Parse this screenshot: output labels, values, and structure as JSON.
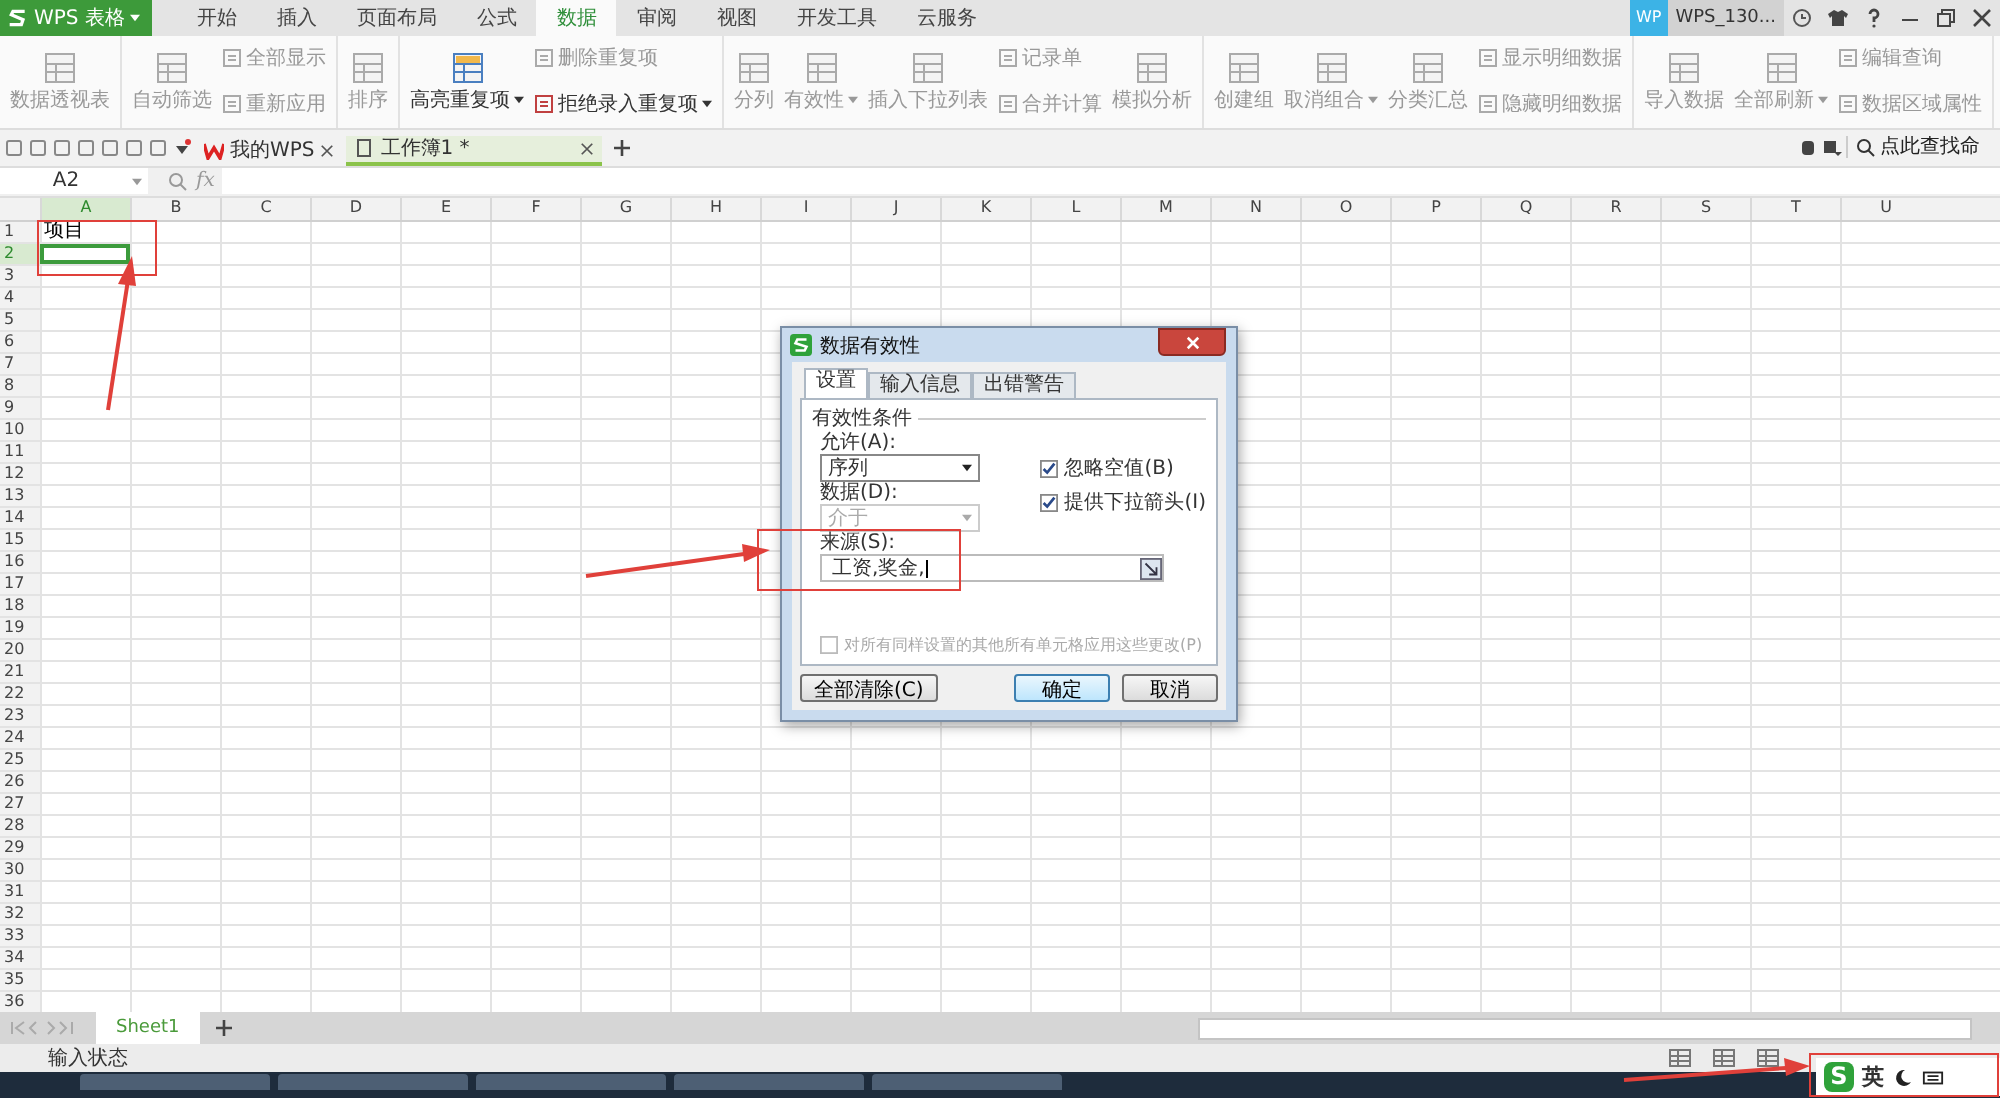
{
  "app_button": {
    "label": "WPS 表格"
  },
  "ribbon_tabs": [
    {
      "label": "开始",
      "selected": false
    },
    {
      "label": "插入",
      "selected": false
    },
    {
      "label": "页面布局",
      "selected": false
    },
    {
      "label": "公式",
      "selected": false
    },
    {
      "label": "数据",
      "selected": true
    },
    {
      "label": "审阅",
      "selected": false
    },
    {
      "label": "视图",
      "selected": false
    },
    {
      "label": "开发工具",
      "selected": false
    },
    {
      "label": "云服务",
      "selected": false
    }
  ],
  "account": {
    "badge": "WP",
    "name": "WPS_130..."
  },
  "ribbon_groups": [
    {
      "columns": [
        [
          {
            "label": "数据透视表",
            "kind": "large",
            "dropdown": false,
            "disabled": true
          }
        ]
      ]
    },
    {
      "columns": [
        [
          {
            "label": "自动筛选",
            "kind": "large",
            "dropdown": false,
            "disabled": true
          }
        ],
        [
          {
            "label": "全部显示",
            "kind": "small",
            "dropdown": false,
            "disabled": true
          },
          {
            "label": "重新应用",
            "kind": "small",
            "dropdown": false,
            "disabled": true
          }
        ]
      ]
    },
    {
      "columns": [
        [
          {
            "label": "排序",
            "kind": "large",
            "dropdown": false,
            "disabled": true
          }
        ]
      ]
    },
    {
      "columns": [
        [
          {
            "label": "高亮重复项",
            "kind": "large",
            "dropdown": true,
            "disabled": false
          }
        ],
        [
          {
            "label": "删除重复项",
            "kind": "small",
            "dropdown": false,
            "disabled": true
          },
          {
            "label": "拒绝录入重复项",
            "kind": "small",
            "dropdown": true,
            "disabled": false
          }
        ]
      ]
    },
    {
      "columns": [
        [
          {
            "label": "分列",
            "kind": "large",
            "dropdown": false,
            "disabled": true
          }
        ],
        [
          {
            "label": "有效性",
            "kind": "large",
            "dropdown": true,
            "disabled": true
          }
        ],
        [
          {
            "label": "插入下拉列表",
            "kind": "large",
            "dropdown": false,
            "disabled": true
          }
        ],
        [
          {
            "label": "记录单",
            "kind": "small",
            "dropdown": false,
            "disabled": true
          },
          {
            "label": "合并计算",
            "kind": "small",
            "dropdown": false,
            "disabled": true
          }
        ],
        [
          {
            "label": "模拟分析",
            "kind": "large",
            "dropdown": false,
            "disabled": true
          }
        ]
      ]
    },
    {
      "columns": [
        [
          {
            "label": "创建组",
            "kind": "large",
            "dropdown": false,
            "disabled": true
          }
        ],
        [
          {
            "label": "取消组合",
            "kind": "large",
            "dropdown": true,
            "disabled": true
          }
        ],
        [
          {
            "label": "分类汇总",
            "kind": "large",
            "dropdown": false,
            "disabled": true
          }
        ],
        [
          {
            "label": "显示明细数据",
            "kind": "small",
            "dropdown": false,
            "disabled": true
          },
          {
            "label": "隐藏明细数据",
            "kind": "small",
            "dropdown": false,
            "disabled": true
          }
        ]
      ]
    },
    {
      "columns": [
        [
          {
            "label": "导入数据",
            "kind": "large",
            "dropdown": false,
            "disabled": true
          }
        ],
        [
          {
            "label": "全部刷新",
            "kind": "large",
            "dropdown": true,
            "disabled": true
          }
        ],
        [
          {
            "label": "编辑查询",
            "kind": "small",
            "dropdown": false,
            "disabled": true
          },
          {
            "label": "数据区域属性",
            "kind": "small",
            "dropdown": false,
            "disabled": true
          }
        ]
      ]
    }
  ],
  "doc_tabs": [
    {
      "label": "我的WPS",
      "selected": false
    },
    {
      "label": "工作簿1 *",
      "selected": true
    }
  ],
  "command_search": {
    "placeholder": "点此查找命"
  },
  "formula_bar": {
    "cell_name": "A2",
    "fx_label": "fx"
  },
  "sheet": {
    "columns": [
      {
        "label": "A",
        "selected": true
      },
      {
        "label": "B",
        "selected": false
      },
      {
        "label": "C",
        "selected": false
      },
      {
        "label": "D",
        "selected": false
      },
      {
        "label": "E",
        "selected": false
      },
      {
        "label": "F",
        "selected": false
      },
      {
        "label": "G",
        "selected": false
      },
      {
        "label": "H",
        "selected": false
      },
      {
        "label": "I",
        "selected": false
      },
      {
        "label": "J",
        "selected": false
      },
      {
        "label": "K",
        "selected": false
      },
      {
        "label": "L",
        "selected": false
      },
      {
        "label": "M",
        "selected": false
      },
      {
        "label": "N",
        "selected": false
      },
      {
        "label": "O",
        "selected": false
      },
      {
        "label": "P",
        "selected": false
      },
      {
        "label": "Q",
        "selected": false
      },
      {
        "label": "R",
        "selected": false
      },
      {
        "label": "S",
        "selected": false
      },
      {
        "label": "T",
        "selected": false
      },
      {
        "label": "U",
        "selected": false
      }
    ],
    "rows": [
      {
        "label": "1",
        "selected": false,
        "cells": [
          "项目"
        ]
      },
      {
        "label": "2",
        "selected": true
      },
      {
        "label": "3",
        "selected": false
      },
      {
        "label": "4",
        "selected": false
      },
      {
        "label": "5",
        "selected": false
      },
      {
        "label": "6",
        "selected": false
      },
      {
        "label": "7",
        "selected": false
      },
      {
        "label": "8",
        "selected": false
      },
      {
        "label": "9",
        "selected": false
      },
      {
        "label": "10",
        "selected": false
      },
      {
        "label": "11",
        "selected": false
      },
      {
        "label": "12",
        "selected": false
      },
      {
        "label": "13",
        "selected": false
      },
      {
        "label": "14",
        "selected": false
      },
      {
        "label": "15",
        "selected": false
      },
      {
        "label": "16",
        "selected": false
      },
      {
        "label": "17",
        "selected": false
      },
      {
        "label": "18",
        "selected": false
      },
      {
        "label": "19",
        "selected": false
      },
      {
        "label": "20",
        "selected": false
      },
      {
        "label": "21",
        "selected": false
      },
      {
        "label": "22",
        "selected": false
      },
      {
        "label": "23",
        "selected": false
      },
      {
        "label": "24",
        "selected": false
      },
      {
        "label": "25",
        "selected": false
      },
      {
        "label": "26",
        "selected": false
      },
      {
        "label": "27",
        "selected": false
      },
      {
        "label": "28",
        "selected": false
      },
      {
        "label": "29",
        "selected": false
      },
      {
        "label": "30",
        "selected": false
      },
      {
        "label": "31",
        "selected": false
      },
      {
        "label": "32",
        "selected": false
      },
      {
        "label": "33",
        "selected": false
      },
      {
        "label": "34",
        "selected": false
      },
      {
        "label": "35",
        "selected": false
      },
      {
        "label": "36",
        "selected": false
      }
    ]
  },
  "sheet_tabs": [
    {
      "label": "Sheet1",
      "selected": true
    }
  ],
  "status_bar": {
    "input_state": "输入状态"
  },
  "ime": {
    "logo": "S",
    "mode": "英"
  },
  "dialog": {
    "title": "数据有效性",
    "tabs": [
      {
        "label": "设置",
        "selected": true
      },
      {
        "label": "输入信息",
        "selected": false
      },
      {
        "label": "出错警告",
        "selected": false
      }
    ],
    "group_title": "有效性条件",
    "allow": {
      "label": "允许(A):",
      "value": "序列",
      "disabled": false
    },
    "data": {
      "label": "数据(D):",
      "value": "介于",
      "disabled": true
    },
    "checkboxes": [
      {
        "label": "忽略空值(B)",
        "checked": true,
        "disabled": false
      },
      {
        "label": "提供下拉箭头(I)",
        "checked": true,
        "disabled": false
      }
    ],
    "source": {
      "label": "来源(S):",
      "value": "工资,奖金,"
    },
    "apply_all": {
      "label": "对所有同样设置的其他所有单元格应用这些更改(P)",
      "checked": false,
      "disabled": true
    },
    "buttons": [
      {
        "label": "全部清除(C)",
        "kind": "plain"
      },
      {
        "label": "确定",
        "kind": "default"
      },
      {
        "label": "取消",
        "kind": "plain"
      }
    ]
  }
}
